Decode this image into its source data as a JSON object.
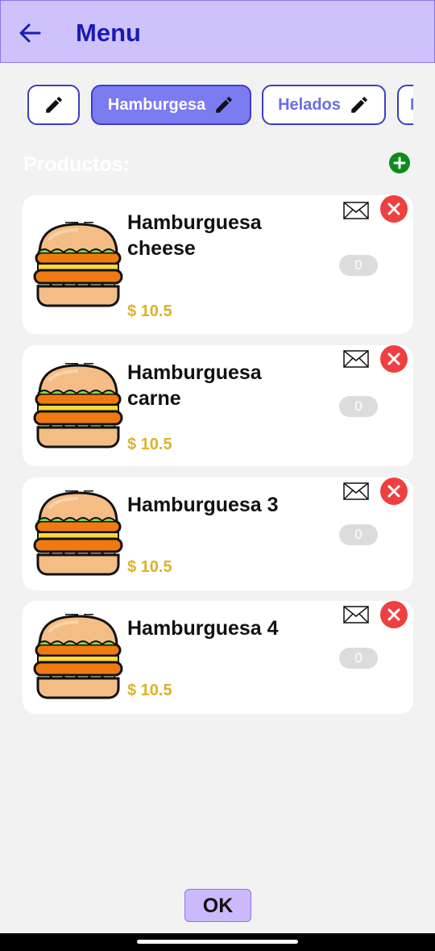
{
  "appbar": {
    "title": "Menu",
    "back_icon": "arrow-left-icon"
  },
  "categories": [
    {
      "label": "",
      "active": false,
      "icon": "pencil-icon"
    },
    {
      "label": "Hamburgesa",
      "active": true,
      "icon": "pencil-icon"
    },
    {
      "label": "Helados",
      "active": false,
      "icon": "pencil-icon"
    },
    {
      "label": "I",
      "active": false,
      "icon": "pencil-icon"
    }
  ],
  "section": {
    "label": "Productos:",
    "add_icon": "plus-circle-icon"
  },
  "products": [
    {
      "name": "Hamburguesa cheese",
      "price": "$ 10.5",
      "quantity": "0"
    },
    {
      "name": "Hamburguesa carne",
      "price": "$ 10.5",
      "quantity": "0"
    },
    {
      "name": "Hamburguesa 3",
      "price": "$ 10.5",
      "quantity": "0"
    },
    {
      "name": "Hamburguesa 4",
      "price": "$ 10.5",
      "quantity": "0"
    }
  ],
  "footer": {
    "ok_label": "OK"
  },
  "colors": {
    "appbar": "#cfc2fc",
    "title": "#1a1ab5",
    "chip_active": "#7b7bf2",
    "price": "#dcb227",
    "delete": "#ee4040",
    "add": "#0e8a1e"
  }
}
